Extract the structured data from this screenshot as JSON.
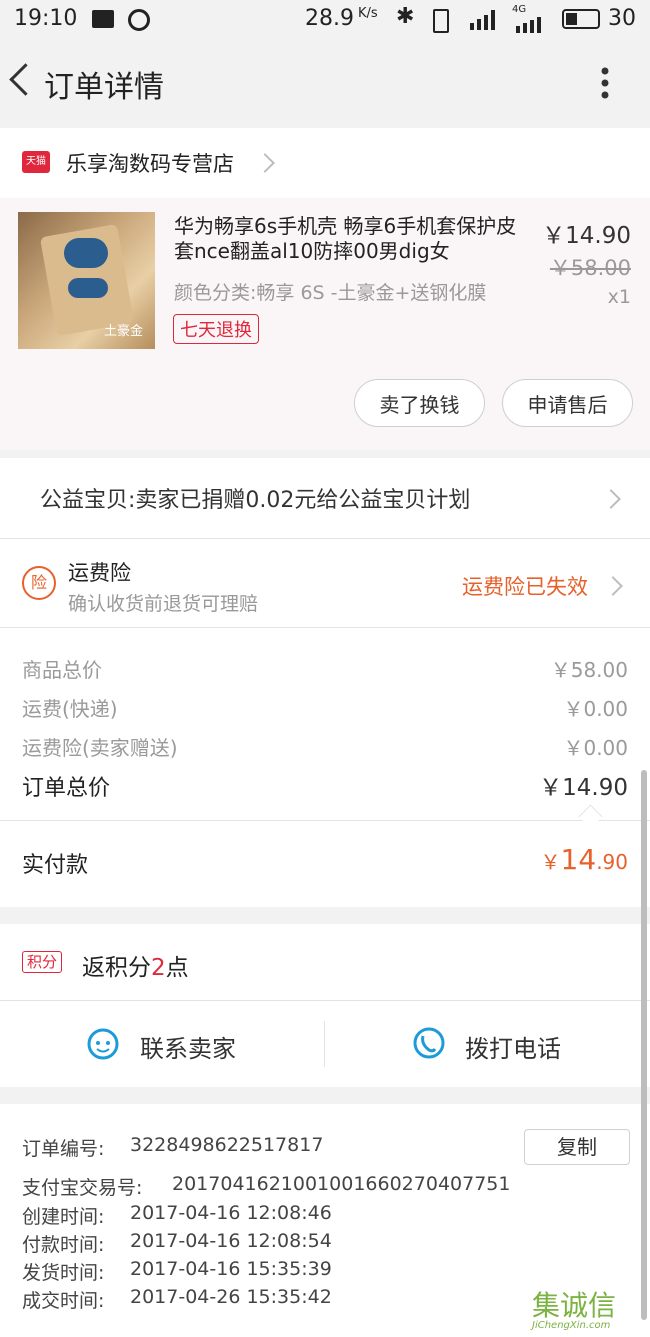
{
  "status_bar": {
    "time": "19:10",
    "speed": "28.9",
    "speed_unit": "K/s",
    "network": "4G",
    "battery": "30"
  },
  "nav": {
    "title": "订单详情"
  },
  "store": {
    "badge": "天猫",
    "name": "乐享淘数码专营店"
  },
  "product": {
    "title": "华为畅享6s手机壳 畅享6手机套保护皮套nce翻盖al10防摔00男dig女",
    "variant": "颜色分类:畅享 6S -土豪金+送钢化膜",
    "tag": "七天退换",
    "price": "￥14.90",
    "original_price": "￥58.00",
    "quantity": "x1",
    "thumb_label": "土豪金"
  },
  "actions": {
    "sell_label": "卖了换钱",
    "aftersale_label": "申请售后"
  },
  "charity": {
    "text": "公益宝贝:卖家已捐赠0.02元给公益宝贝计划"
  },
  "insurance": {
    "icon_char": "险",
    "title": "运费险",
    "subtitle": "确认收货前退货可理赔",
    "status": "运费险已失效"
  },
  "fees": [
    {
      "label": "商品总价",
      "value": "￥58.00"
    },
    {
      "label": "运费(快递)",
      "value": "￥0.00"
    },
    {
      "label": "运费险(卖家赠送)",
      "value": "￥0.00"
    }
  ],
  "total": {
    "label": "订单总价",
    "value": "￥14.90"
  },
  "paid": {
    "label": "实付款",
    "currency": "￥",
    "integer": "14",
    "decimal": ".90"
  },
  "points": {
    "badge": "积分",
    "prefix": "返积分",
    "count": "2",
    "suffix": "点"
  },
  "contact": {
    "seller_label": "联系卖家",
    "phone_label": "拨打电话"
  },
  "order_info": {
    "copy_label": "复制",
    "rows": [
      {
        "label": "订单编号:",
        "value": "3228498622517817"
      },
      {
        "label": "支付宝交易号:",
        "value": "2017041621001001660270407751"
      },
      {
        "label": "创建时间:",
        "value": "2017-04-16 12:08:46"
      },
      {
        "label": "付款时间:",
        "value": "2017-04-16 12:08:54"
      },
      {
        "label": "发货时间:",
        "value": "2017-04-16 15:35:39"
      },
      {
        "label": "成交时间:",
        "value": "2017-04-26 15:35:42"
      }
    ]
  },
  "watermark": {
    "brand": "集诚信",
    "url": "JiChengXin.com"
  },
  "colors": {
    "accent": "#e6612b",
    "tmall_red": "#e0283c",
    "blue_icon": "#1d9bd8"
  }
}
